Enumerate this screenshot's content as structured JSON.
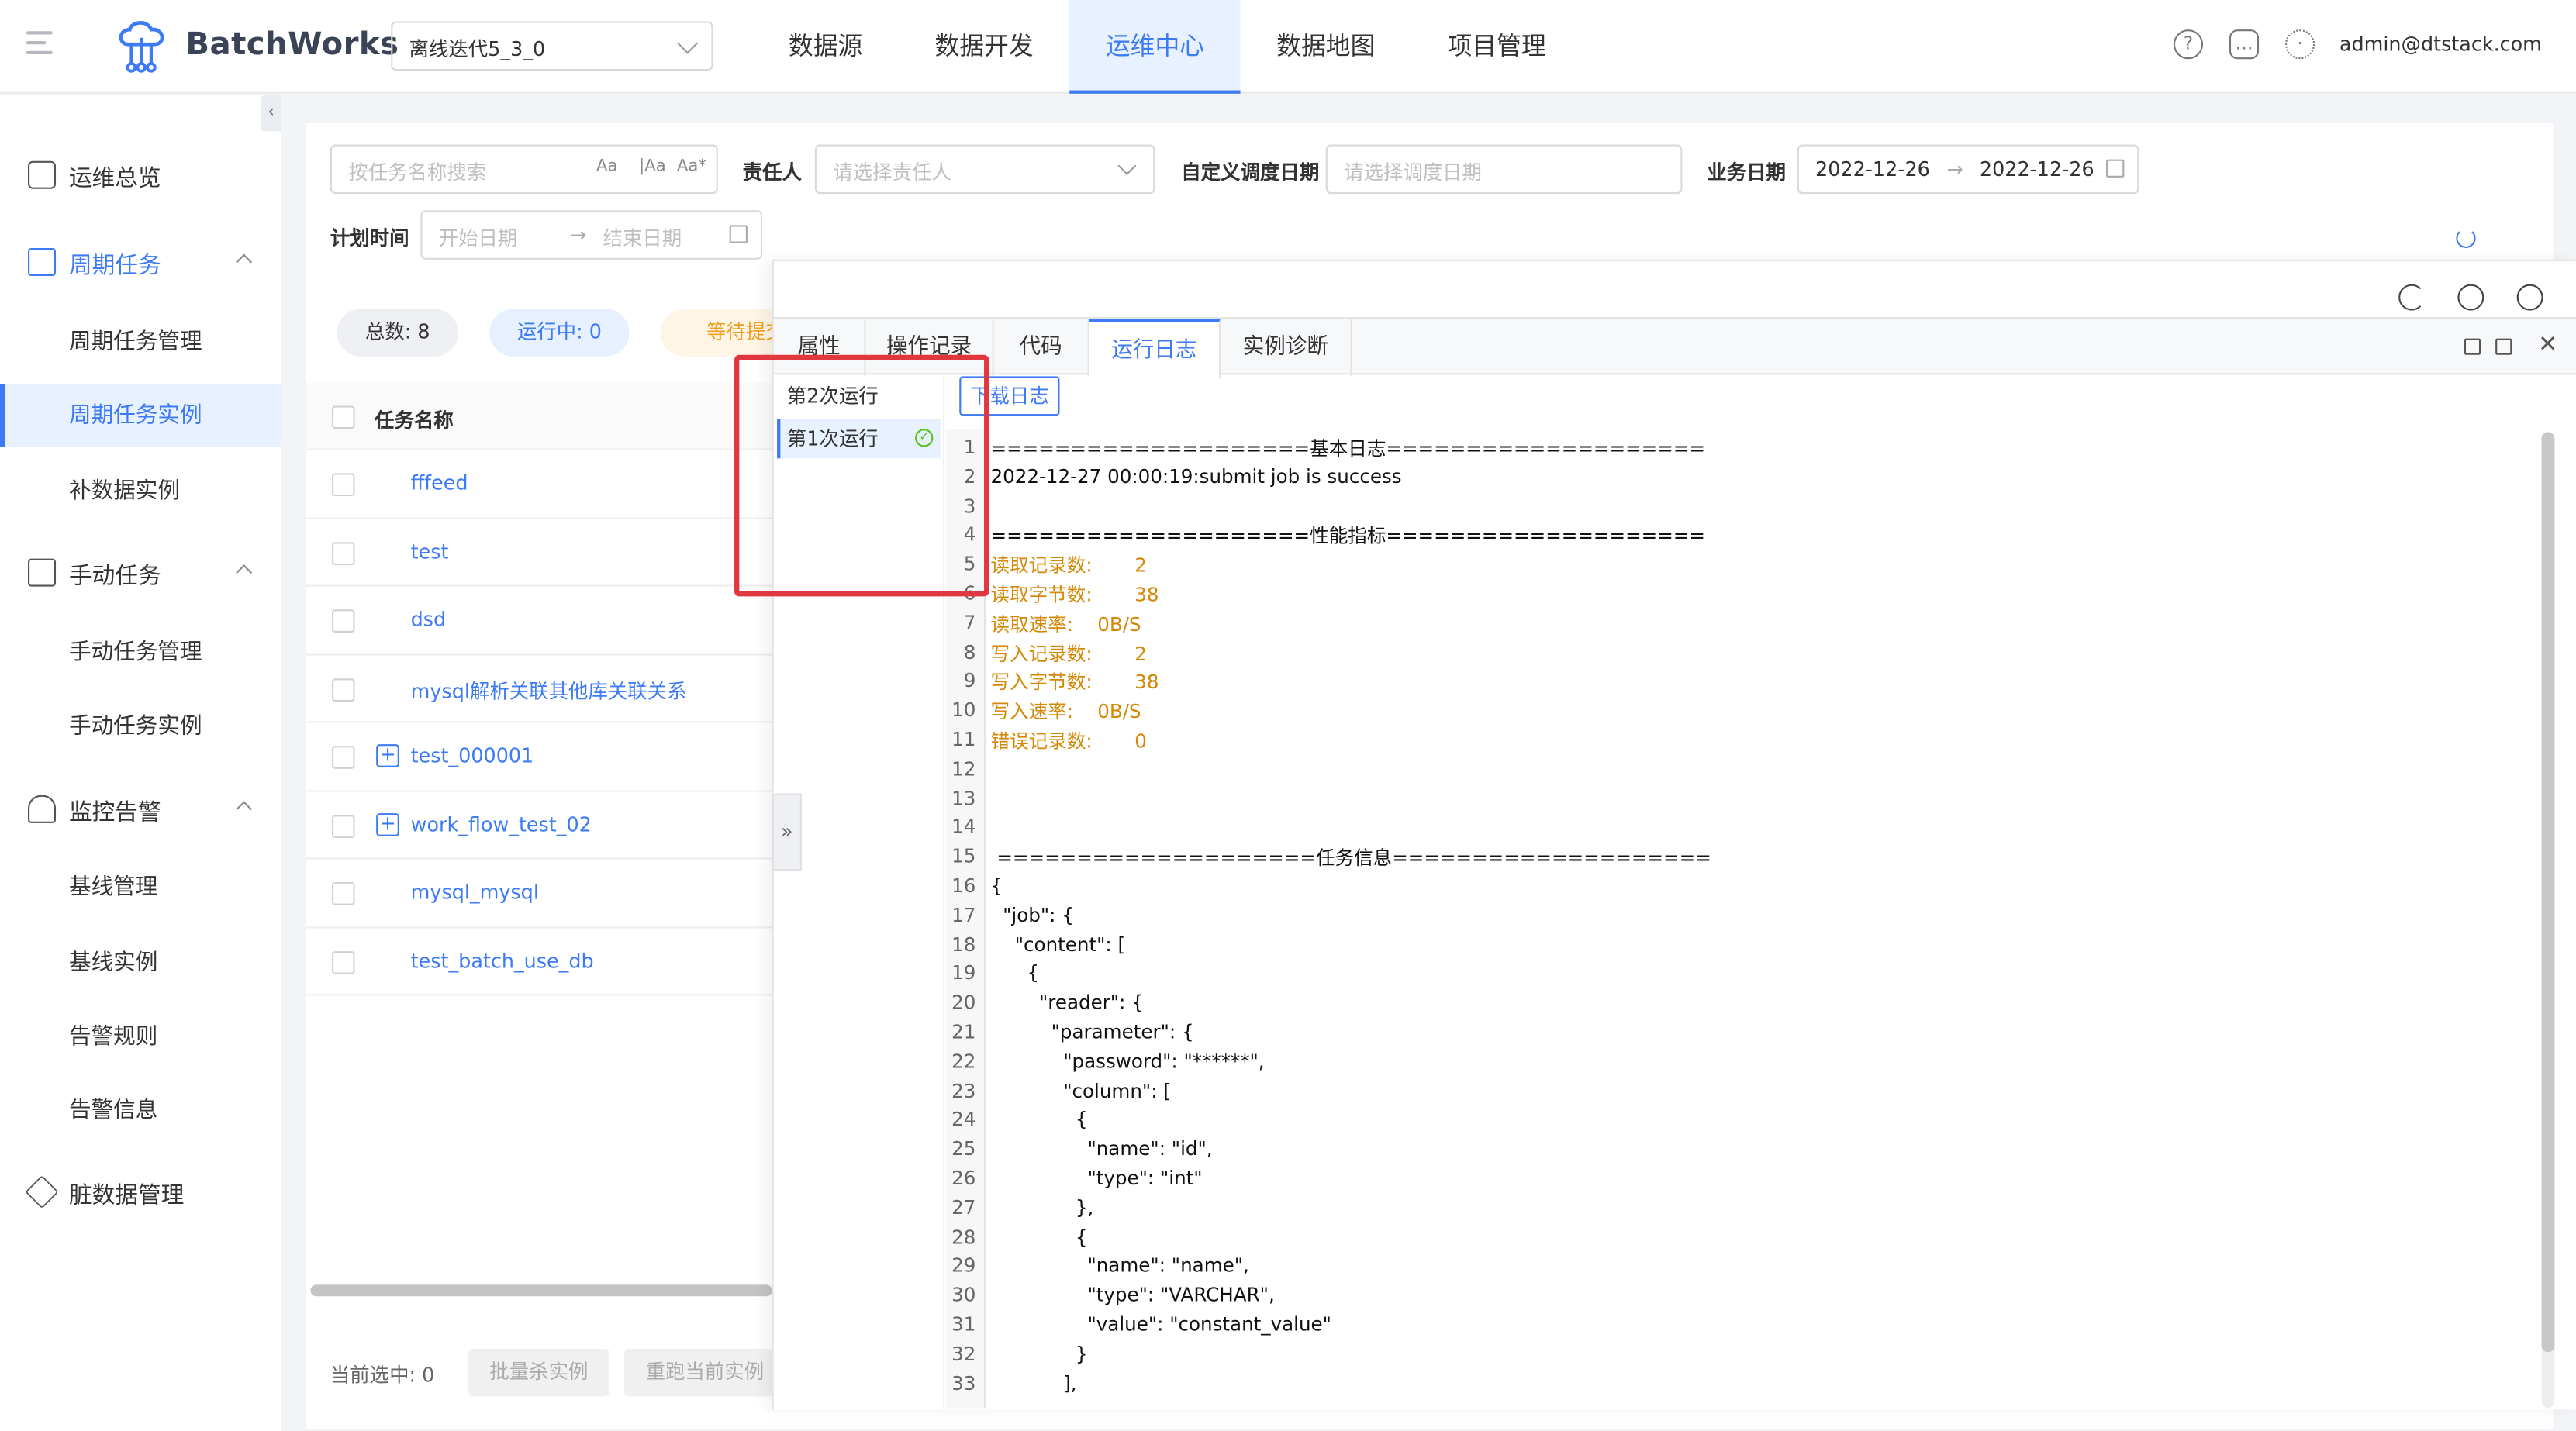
{
  "app": {
    "name": "BatchWorks",
    "project": "离线迭代5_3_0",
    "user": "admin@dtstack.com"
  },
  "nav": [
    "数据源",
    "数据开发",
    "运维中心",
    "数据地图",
    "项目管理"
  ],
  "sidebar": {
    "overview": "运维总览",
    "periodic": {
      "label": "周期任务",
      "items": [
        "周期任务管理",
        "周期任务实例",
        "补数据实例"
      ]
    },
    "manual": {
      "label": "手动任务",
      "items": [
        "手动任务管理",
        "手动任务实例"
      ]
    },
    "monitor": {
      "label": "监控告警",
      "items": [
        "基线管理",
        "基线实例",
        "告警规则",
        "告警信息"
      ]
    },
    "dirty": "脏数据管理"
  },
  "filters": {
    "search_placeholder": "按任务名称搜索",
    "owner_label": "责任人",
    "owner_placeholder": "请选择责任人",
    "custom_date_label": "自定义调度日期",
    "custom_date_placeholder": "请选择调度日期",
    "biz_date_label": "业务日期",
    "biz_start": "2022-12-26",
    "biz_end": "2022-12-26",
    "plan_label": "计划时间",
    "plan_start": "开始日期",
    "plan_end": "结束日期",
    "arrow": "→"
  },
  "stats": {
    "total": "总数: 8",
    "running": "运行中: 0",
    "waiting": "等待提交"
  },
  "table": {
    "header": "任务名称",
    "rows": [
      "fffeed",
      "test",
      "dsd",
      "mysql解析关联其他库关联关系",
      "test_000001",
      "work_flow_test_02",
      "mysql_mysql",
      "test_batch_use_db"
    ]
  },
  "footer": {
    "selected": "当前选中: 0",
    "batch_kill": "批量杀实例",
    "rerun": "重跑当前实例"
  },
  "drawer": {
    "tabs": [
      "属性",
      "操作记录",
      "代码",
      "运行日志",
      "实例诊断"
    ],
    "runs": [
      "第2次运行",
      "第1次运行"
    ],
    "download": "下载日志",
    "log": [
      "====================基本日志====================",
      "2022-12-27 00:00:19:submit job is success",
      "",
      "====================性能指标====================",
      "读取记录数:       2",
      "读取字节数:       38",
      "读取速率:    0B/S",
      "写入记录数:       2",
      "写入字节数:       38",
      "写入速率:    0B/S",
      "错误记录数:       0",
      "",
      "",
      "",
      " ====================任务信息====================",
      "{",
      "  \"job\": {",
      "    \"content\": [",
      "      {",
      "        \"reader\": {",
      "          \"parameter\": {",
      "            \"password\": \"******\",",
      "            \"column\": [",
      "              {",
      "                \"name\": \"id\",",
      "                \"type\": \"int\"",
      "              },",
      "              {",
      "                \"name\": \"name\",",
      "                \"type\": \"VARCHAR\",",
      "                \"value\": \"constant_value\"",
      "              }",
      "            ],"
    ]
  }
}
